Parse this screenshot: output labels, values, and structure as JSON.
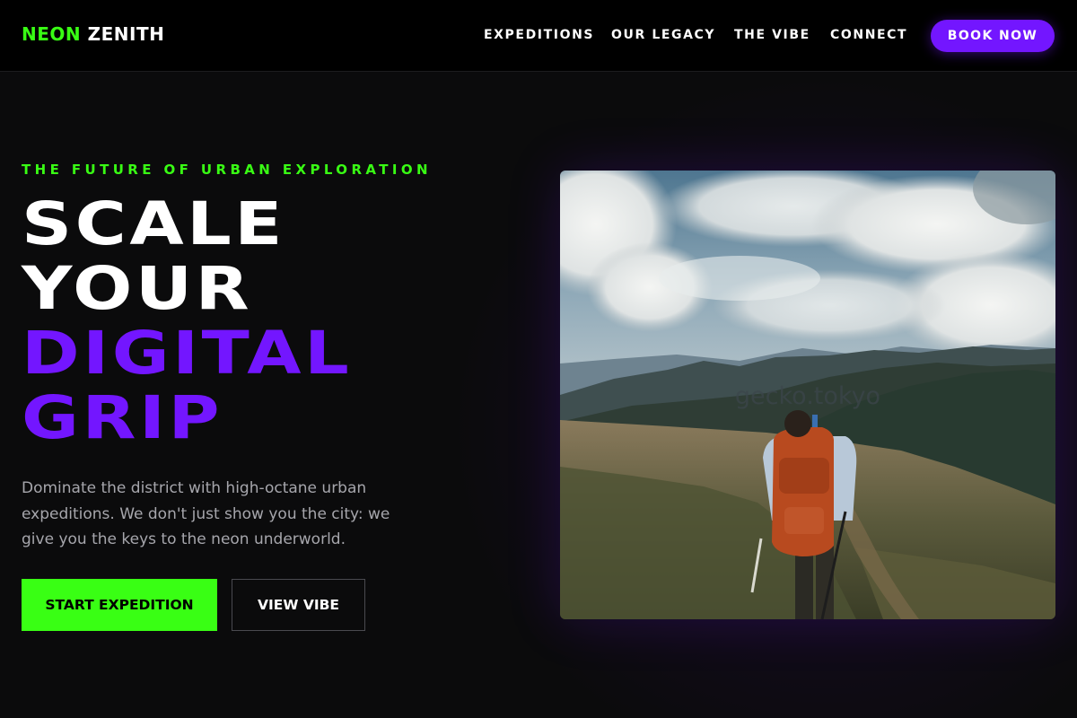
{
  "brand": {
    "name_accent": "NEON",
    "name_rest": "ZENITH",
    "accent_color": "#39ff14",
    "purple_color": "#7316ff"
  },
  "nav": {
    "items": [
      {
        "label": "EXPEDITIONS"
      },
      {
        "label": "OUR LEGACY"
      },
      {
        "label": "THE VIBE"
      },
      {
        "label": "CONNECT"
      }
    ],
    "cta_label": "BOOK NOW"
  },
  "hero": {
    "eyebrow": "THE FUTURE OF URBAN EXPLORATION",
    "headline_lines": [
      "SCALE",
      "YOUR",
      "DIGITAL",
      "GRIP"
    ],
    "description": "Dominate the district with high-octane urban expeditions. We don't just show you the city: we give you the keys to the neon underworld.",
    "primary_button": "START EXPEDITION",
    "secondary_button": "VIEW VIBE",
    "image_watermark": "gecko.tokyo"
  }
}
